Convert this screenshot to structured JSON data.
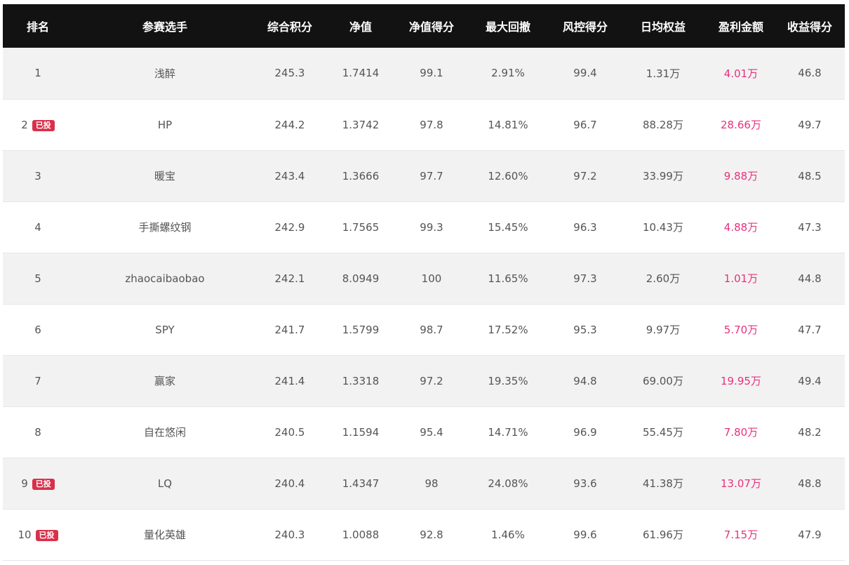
{
  "table": {
    "headers": [
      "排名",
      "参赛选手",
      "综合积分",
      "净值",
      "净值得分",
      "最大回撤",
      "风控得分",
      "日均权益",
      "盈利金额",
      "收益得分"
    ],
    "badge_label": "已投",
    "profit_color": "#e8317d",
    "rows": [
      {
        "rank": "1",
        "invested": false,
        "player": "浅醉",
        "score": "245.3",
        "nav": "1.7414",
        "nav_score": "99.1",
        "max_drawdown": "2.91%",
        "risk_score": "99.4",
        "daily_equity": "1.31万",
        "profit": "4.01万",
        "return_score": "46.8"
      },
      {
        "rank": "2",
        "invested": true,
        "player": "HP",
        "score": "244.2",
        "nav": "1.3742",
        "nav_score": "97.8",
        "max_drawdown": "14.81%",
        "risk_score": "96.7",
        "daily_equity": "88.28万",
        "profit": "28.66万",
        "return_score": "49.7"
      },
      {
        "rank": "3",
        "invested": false,
        "player": "暖宝",
        "score": "243.4",
        "nav": "1.3666",
        "nav_score": "97.7",
        "max_drawdown": "12.60%",
        "risk_score": "97.2",
        "daily_equity": "33.99万",
        "profit": "9.88万",
        "return_score": "48.5"
      },
      {
        "rank": "4",
        "invested": false,
        "player": "手撕螺纹钢",
        "score": "242.9",
        "nav": "1.7565",
        "nav_score": "99.3",
        "max_drawdown": "15.45%",
        "risk_score": "96.3",
        "daily_equity": "10.43万",
        "profit": "4.88万",
        "return_score": "47.3"
      },
      {
        "rank": "5",
        "invested": false,
        "player": "zhaocaibaobao",
        "score": "242.1",
        "nav": "8.0949",
        "nav_score": "100",
        "max_drawdown": "11.65%",
        "risk_score": "97.3",
        "daily_equity": "2.60万",
        "profit": "1.01万",
        "return_score": "44.8"
      },
      {
        "rank": "6",
        "invested": false,
        "player": "SPY",
        "score": "241.7",
        "nav": "1.5799",
        "nav_score": "98.7",
        "max_drawdown": "17.52%",
        "risk_score": "95.3",
        "daily_equity": "9.97万",
        "profit": "5.70万",
        "return_score": "47.7"
      },
      {
        "rank": "7",
        "invested": false,
        "player": "赢家",
        "score": "241.4",
        "nav": "1.3318",
        "nav_score": "97.2",
        "max_drawdown": "19.35%",
        "risk_score": "94.8",
        "daily_equity": "69.00万",
        "profit": "19.95万",
        "return_score": "49.4"
      },
      {
        "rank": "8",
        "invested": false,
        "player": "自在悠闲",
        "score": "240.5",
        "nav": "1.1594",
        "nav_score": "95.4",
        "max_drawdown": "14.71%",
        "risk_score": "96.9",
        "daily_equity": "55.45万",
        "profit": "7.80万",
        "return_score": "48.2"
      },
      {
        "rank": "9",
        "invested": true,
        "player": "LQ",
        "score": "240.4",
        "nav": "1.4347",
        "nav_score": "98",
        "max_drawdown": "24.08%",
        "risk_score": "93.6",
        "daily_equity": "41.38万",
        "profit": "13.07万",
        "return_score": "48.8"
      },
      {
        "rank": "10",
        "invested": true,
        "player": "量化英雄",
        "score": "240.3",
        "nav": "1.0088",
        "nav_score": "92.8",
        "max_drawdown": "1.46%",
        "risk_score": "99.6",
        "daily_equity": "61.96万",
        "profit": "7.15万",
        "return_score": "47.9"
      }
    ]
  }
}
